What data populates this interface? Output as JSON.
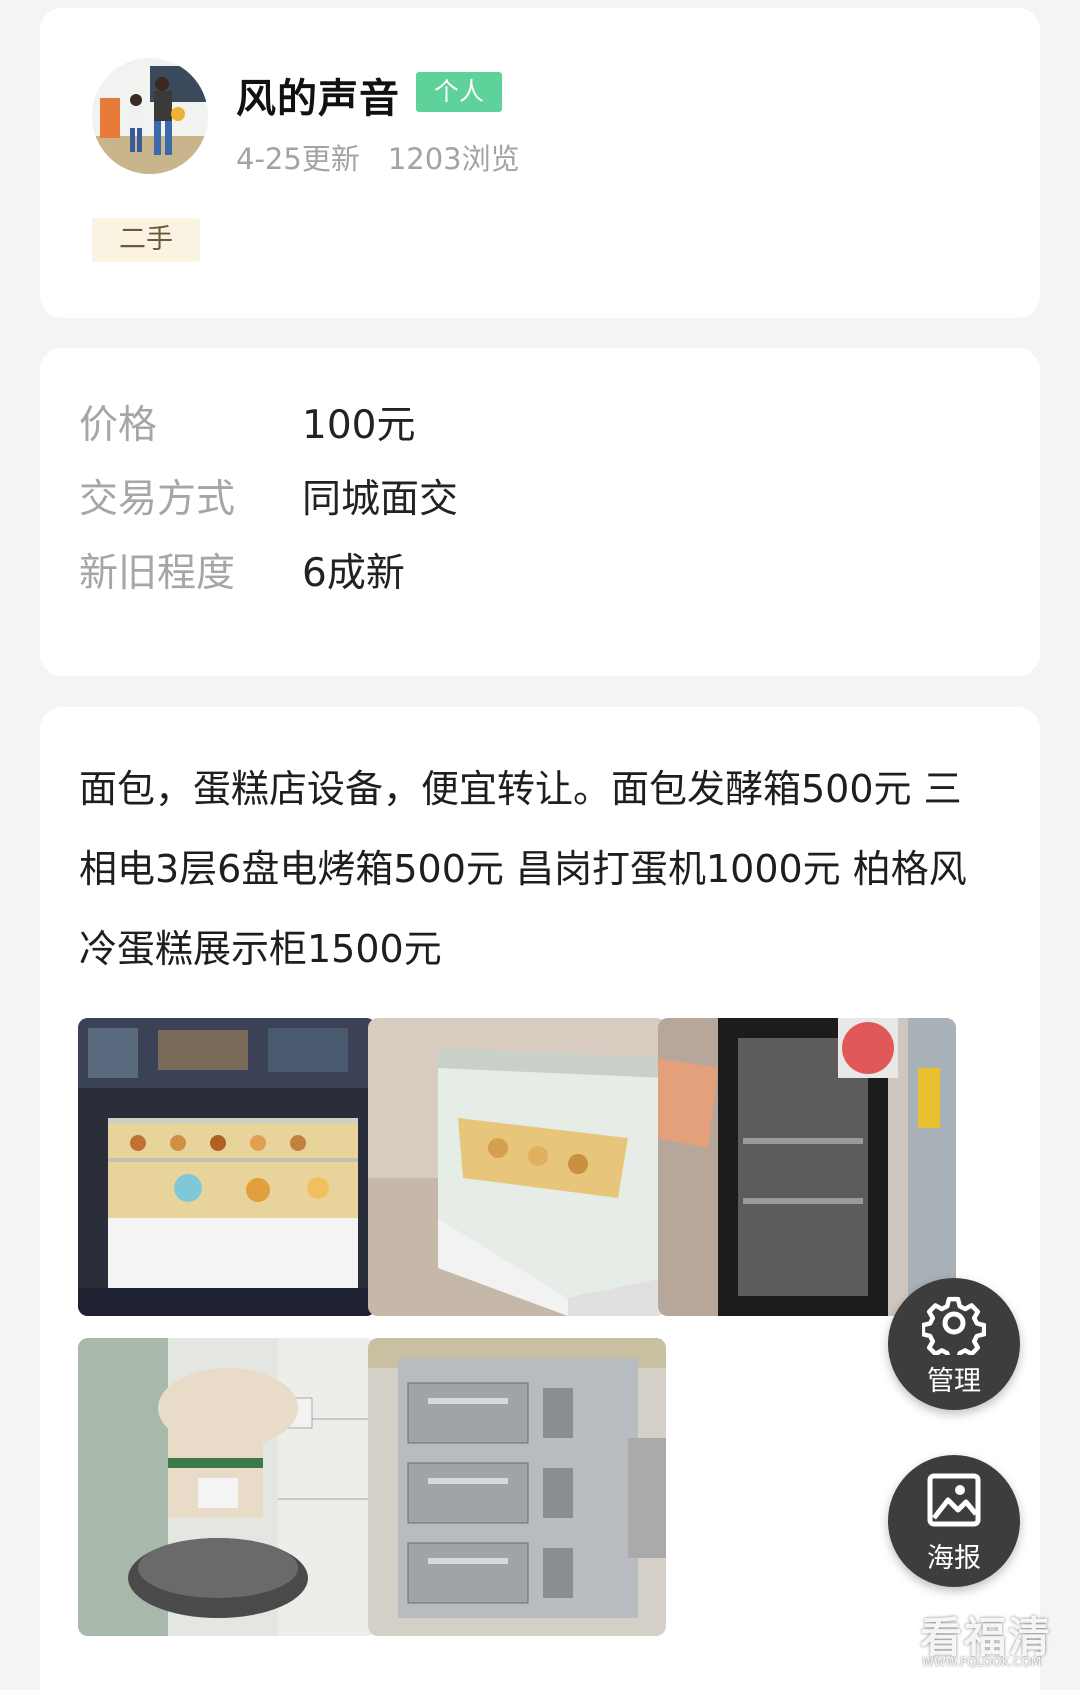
{
  "profile": {
    "name": "风的声音",
    "tag": "个人",
    "updated": "4-25更新",
    "views": "1203浏览",
    "category": "二手"
  },
  "details": [
    {
      "label": "价格",
      "value": "100元"
    },
    {
      "label": "交易方式",
      "value": "同城面交"
    },
    {
      "label": "新旧程度",
      "value": "6成新"
    }
  ],
  "description": "面包，蛋糕店设备，便宜转让。面包发酵箱500元 三相电3层6盘电烤箱500元 昌岗打蛋机1000元 柏格风冷蛋糕展示柜1500元",
  "photos": [
    {
      "icon": "cake-display-cabinet-photo"
    },
    {
      "icon": "glass-display-counter-photo"
    },
    {
      "icon": "proofing-cabinet-photo"
    },
    {
      "icon": "dough-mixer-photo"
    },
    {
      "icon": "electric-oven-photo"
    }
  ],
  "fabs": {
    "manage_label": "管理",
    "poster_label": "海报"
  },
  "watermark": {
    "text": "看福清",
    "url": "WWW.FQLOOK.COM"
  }
}
